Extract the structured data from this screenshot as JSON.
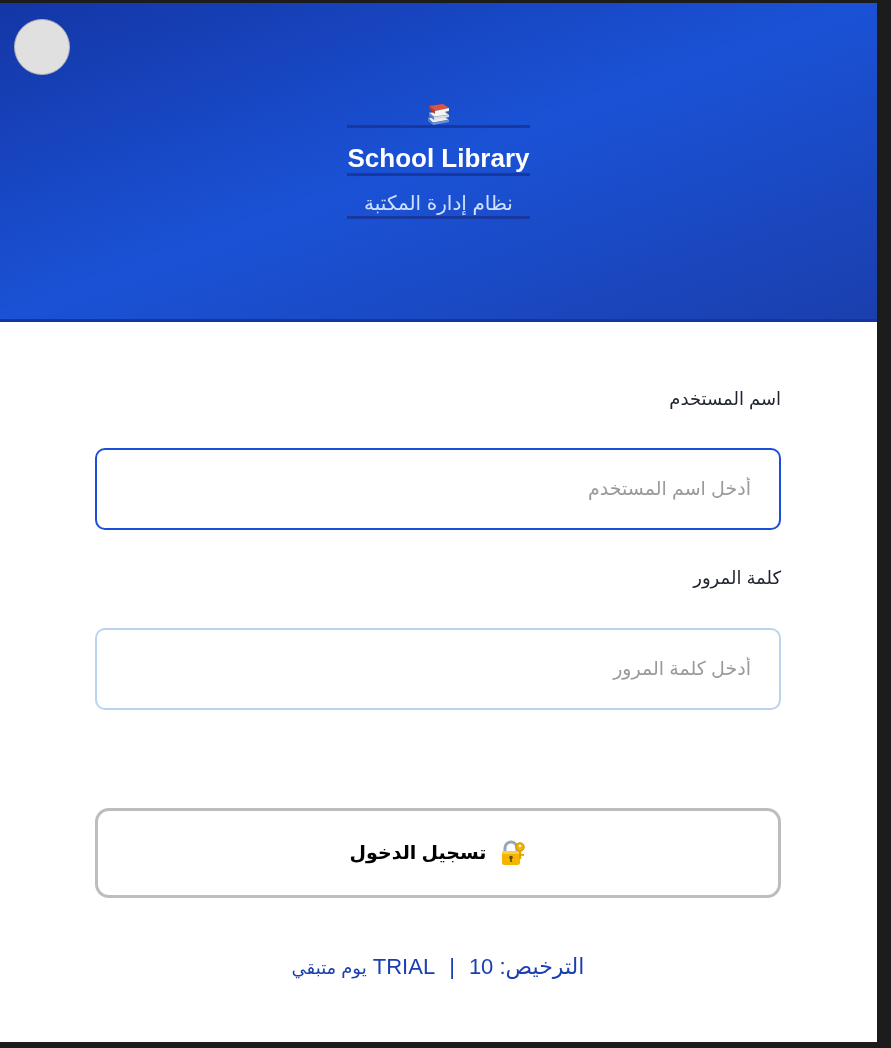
{
  "header": {
    "title": "School Library",
    "subtitle": "نظام إدارة المكتبة"
  },
  "form": {
    "fields": [
      {
        "label": "اسم المستخدم",
        "placeholder": "أدخل اسم المستخدم",
        "focused": true
      },
      {
        "label": "كلمة المرور",
        "placeholder": "أدخل كلمة المرور",
        "focused": false
      }
    ],
    "login_button": {
      "label": "تسجيل الدخول"
    }
  },
  "license": {
    "label": "الترخيص:",
    "type": "TRIAL",
    "separator": "|",
    "days": "10",
    "days_unit": "يوم متبقي"
  }
}
